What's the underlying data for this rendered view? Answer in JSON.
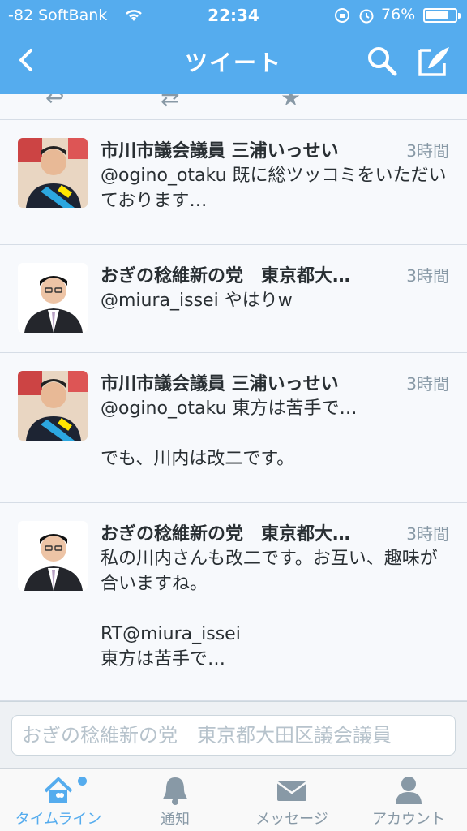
{
  "status_bar": {
    "carrier": "-82 SoftBank",
    "time": "22:34",
    "battery_percent": "76%",
    "battery_level": 0.76
  },
  "nav": {
    "title": "ツイート"
  },
  "tweets": [
    {
      "name": "市川市議会議員 三浦いっせい",
      "time": "3時間",
      "body": "@ogino_otaku 既に総ツッコミをいただいております…",
      "avatar": "campaign-photo"
    },
    {
      "name": "おぎの稔維新の党　東京都大…",
      "time": "3時間",
      "body": "@miura_issei やはりw",
      "avatar": "portrait-photo"
    },
    {
      "name": "市川市議会議員 三浦いっせい",
      "time": "3時間",
      "body": "@ogino_otaku 東方は苦手で…\n\nでも、川内は改二です。",
      "avatar": "campaign-photo"
    },
    {
      "name": "おぎの稔維新の党　東京都大…",
      "time": "3時間",
      "body": "私の川内さんも改二です。お互い、趣味が合いますね。\n\nRT@miura_issei\n東方は苦手で…",
      "avatar": "portrait-photo"
    }
  ],
  "reply": {
    "placeholder": "おぎの稔維新の党　東京都大田区議会議員"
  },
  "tabbar": {
    "items": [
      {
        "label": "タイムライン",
        "icon": "home-icon",
        "active": true
      },
      {
        "label": "通知",
        "icon": "bell-icon",
        "active": false
      },
      {
        "label": "メッセージ",
        "icon": "envelope-icon",
        "active": false
      },
      {
        "label": "アカウント",
        "icon": "person-icon",
        "active": false
      }
    ]
  },
  "colors": {
    "brand": "#55acee",
    "text": "#292f33",
    "muted": "#8899a6"
  }
}
